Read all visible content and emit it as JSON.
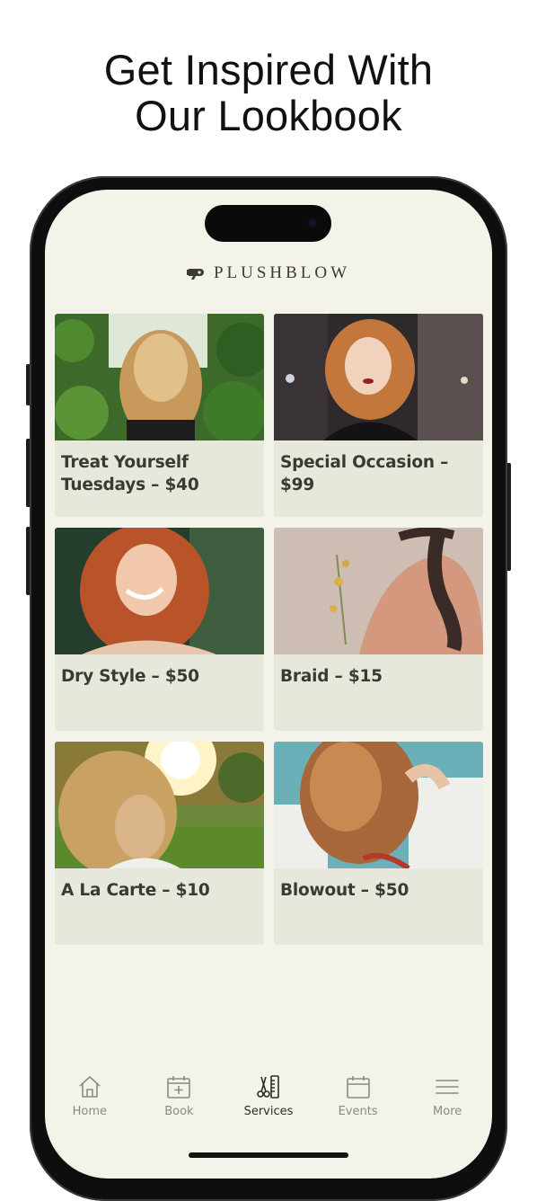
{
  "headline": {
    "line1": "Get Inspired With",
    "line2": "Our Lookbook"
  },
  "app": {
    "logo_text": "PLUSHBLOW",
    "cards": [
      {
        "label": "Treat Yourself Tuesdays – $40"
      },
      {
        "label": "Special Occasion – $99"
      },
      {
        "label": "Dry Style – $50"
      },
      {
        "label": "Braid – $15"
      },
      {
        "label": "A La Carte – $10"
      },
      {
        "label": "Blowout – $50"
      }
    ],
    "tabs": [
      {
        "label": "Home",
        "icon": "home-icon"
      },
      {
        "label": "Book",
        "icon": "calendar-plus-icon"
      },
      {
        "label": "Services",
        "icon": "scissors-comb-icon",
        "active": true
      },
      {
        "label": "Events",
        "icon": "calendar-icon"
      },
      {
        "label": "More",
        "icon": "menu-icon"
      }
    ]
  },
  "colors": {
    "screen_bg": "#f4f3ea",
    "card_bg": "#e7e7dc",
    "card_text": "#3a3a32",
    "tab_inactive": "#8a8a84",
    "tab_active": "#2c2c2a"
  }
}
